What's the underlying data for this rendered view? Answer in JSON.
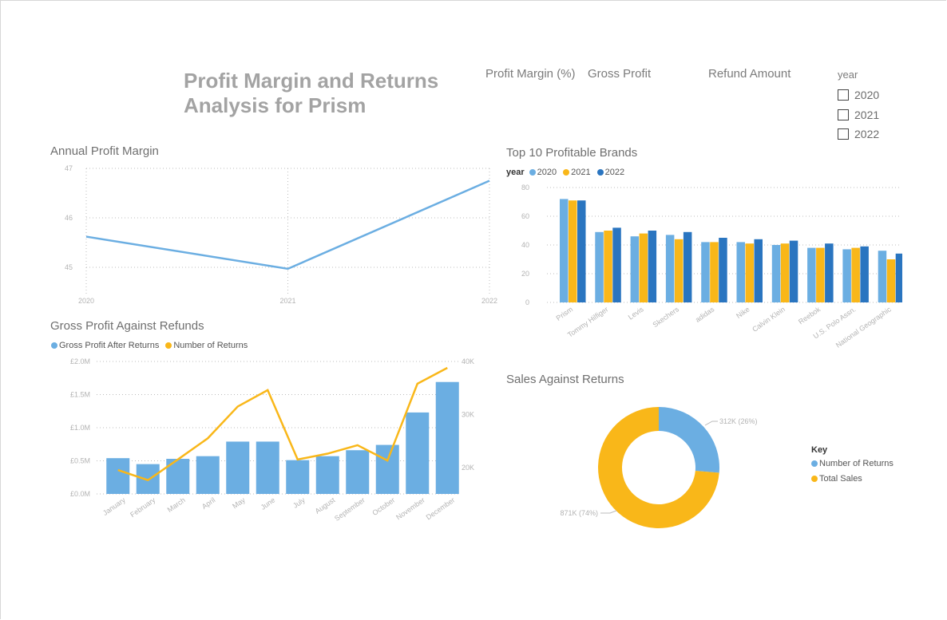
{
  "page": {
    "title": "Profit Margin and Returns Analysis for Prism",
    "kpis": {
      "profit_margin": "Profit Margin (%)",
      "gross_profit": "Gross Profit",
      "refund_amount": "Refund Amount"
    },
    "slicer": {
      "header": "year",
      "options": [
        "2020",
        "2021",
        "2022"
      ]
    }
  },
  "colors": {
    "light_blue": "#6baee2",
    "gold": "#f9b719",
    "dark_blue": "#2a75c0"
  },
  "chart_data": [
    {
      "id": "annual_profit_margin",
      "type": "line",
      "title": "Annual Profit Margin",
      "x": [
        "2020",
        "2021",
        "2022"
      ],
      "series": [
        {
          "values": [
            45.62,
            44.97,
            46.75
          ]
        }
      ],
      "ylim": [
        45,
        47
      ],
      "yticks": [
        "47",
        "46",
        "45"
      ],
      "grid": true
    },
    {
      "id": "top_brands",
      "type": "bar",
      "title": "Top 10 Profitable Brands",
      "legend_title": "year",
      "categories": [
        "Prism",
        "Tommy Hilfiger",
        "Levis",
        "Skechers",
        "adidas",
        "Nike",
        "Calvin Klein",
        "Reebok",
        "U.S. Polo Assn.",
        "National Geographic"
      ],
      "series": [
        {
          "name": "2020",
          "values": [
            72,
            49,
            46,
            47,
            42,
            42,
            40,
            38,
            37,
            36
          ]
        },
        {
          "name": "2021",
          "values": [
            71,
            50,
            48,
            44,
            42,
            41,
            41,
            38,
            38,
            30
          ]
        },
        {
          "name": "2022",
          "values": [
            71,
            52,
            50,
            49,
            45,
            44,
            43,
            41,
            39,
            34
          ]
        }
      ],
      "ylim": [
        0,
        80
      ],
      "yticks": [
        "80",
        "60",
        "40",
        "20",
        "0"
      ],
      "legend_position": "top-left"
    },
    {
      "id": "gross_profit_refunds",
      "type": "bar",
      "title": "Gross Profit Against Refunds",
      "categories": [
        "January",
        "February",
        "March",
        "April",
        "May",
        "June",
        "July",
        "August",
        "September",
        "October",
        "November",
        "December"
      ],
      "series": [
        {
          "name": "Gross Profit After Returns",
          "type": "bar",
          "axis": "left",
          "values": [
            0.54,
            0.45,
            0.53,
            0.57,
            0.79,
            0.79,
            0.51,
            0.57,
            0.66,
            0.74,
            1.23,
            1.69
          ]
        },
        {
          "name": "Number of Returns",
          "type": "line",
          "axis": "right",
          "values": [
            19500,
            17600,
            21500,
            25500,
            31500,
            34600,
            21500,
            22600,
            24200,
            21300,
            35800,
            38800
          ]
        }
      ],
      "left_axis": {
        "ticks": [
          "£2.0M",
          "£1.5M",
          "£1.0M",
          "£0.5M",
          "£0.0M"
        ],
        "range": [
          0,
          2.0
        ]
      },
      "right_axis": {
        "ticks": [
          "40K",
          "30K",
          "20K"
        ],
        "range": [
          15000,
          40000
        ]
      },
      "legend_position": "top-left"
    },
    {
      "id": "sales_vs_returns",
      "type": "pie",
      "title": "Sales Against Returns",
      "legend_title": "Key",
      "slices": [
        {
          "name": "Number of Returns",
          "value": 312,
          "label": "312K (26%)"
        },
        {
          "name": "Total Sales",
          "value": 871,
          "label": "871K (74%)"
        }
      ]
    }
  ]
}
